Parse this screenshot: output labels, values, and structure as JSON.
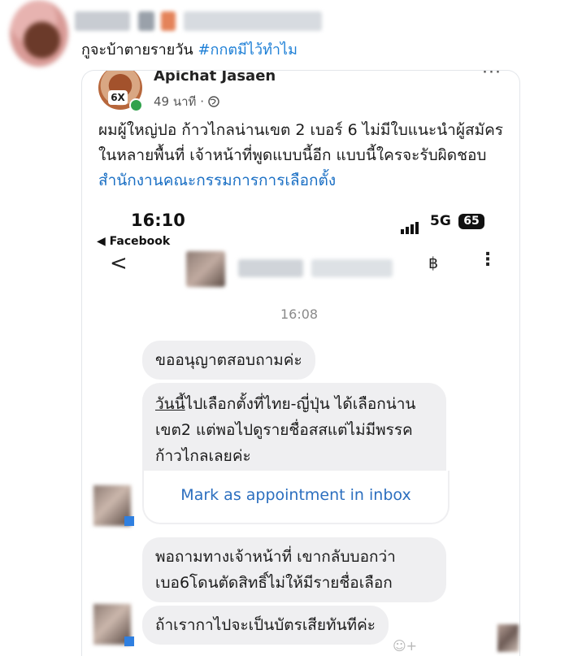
{
  "tweet": {
    "text": "กูจะบ้าตายรายวัน",
    "hashtag": "#กกตมีไว้ทำไม"
  },
  "facebook_post": {
    "author": "Apichat Jasaen",
    "avatar_badge": "6X",
    "time": "49 นาที ·",
    "globe_icon": "globe-icon",
    "body": "ผมผู้ใหญ่ปอ ก้าวไกลน่านเขต 2 เบอร์ 6 ไม่มีใบแนะนำผู้สมัครในหลายพื้นที่ เจ้าหน้าที่พูดแบบนี้อีก แบบนี้ใครจะรับผิดชอบ",
    "link": "สำนักงานคณะกรรมการการเลือกตั้ง"
  },
  "phone": {
    "clock": "16:10",
    "back_app": "◀ Facebook",
    "network": "5G",
    "battery": "65",
    "baht_symbol": "฿",
    "chat_timestamp": "16:08",
    "messages": [
      "ขออนุญาตสอบถามค่ะ",
      "ไปเลือกตั้งที่ไทย-ญี่ปุ่น ได้เลือกน่านเขต2 แต่พอไปดูรายชื่อสสแต่ไม่มีพรรคก้าวไกลเลยค่ะ",
      "พอถามทางเจ้าหน้าที่ เขากลับบอกว่าเบอ6โดนตัดสิทธิ์ไม่ให้มีรายชื่อเลือก",
      "ถ้าเรากาไปจะเป็นบัตรเสียทันทีค่ะ"
    ],
    "msg2_underlined": "วันนี้",
    "appointment_link": "Mark as appointment in inbox"
  }
}
